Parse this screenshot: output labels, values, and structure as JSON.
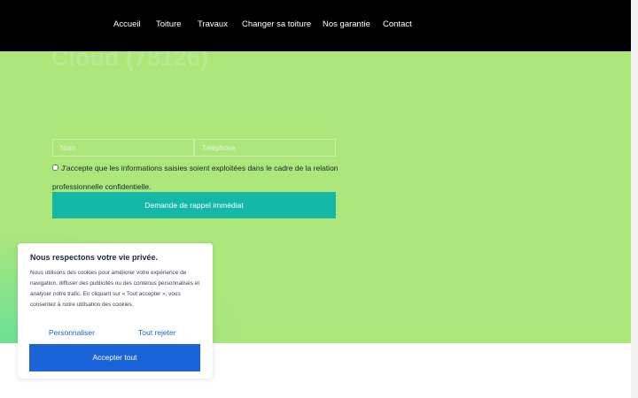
{
  "nav": {
    "items": [
      "Accueil",
      "Toiture",
      "Travaux",
      "Changer sa toiture",
      "Nos garantie",
      "Contact"
    ]
  },
  "hero": {
    "title_line1": "Cloud (78126)"
  },
  "form": {
    "name_placeholder": "Nom",
    "phone_placeholder": "Téléphone",
    "consent_text": "J'accepte que les informations saisies soient exploitées dans le cadre de la relation professionnelle confidentielle.",
    "submit_label": "Demande de rappel immédiat"
  },
  "cookie": {
    "title": "Nous respectons votre vie privée.",
    "text": "Nous utilisons des cookies pour améliorer votre expérience de navigation, diffuser des publicités ou des contenus personnalisés et analyser notre trafic. En cliquant sur « Tout accepter », vous consentez à notre utilisation des cookies.",
    "customize_label": "Personnaliser",
    "reject_label": "Tout rejeter",
    "accept_label": "Accepter tout"
  },
  "colors": {
    "hero_bg": "#ade67b",
    "navbar_bg": "#000000",
    "callback_button": "#14b8a6",
    "accept_button": "#1a63d8",
    "link_blue": "#1d5fd6"
  }
}
